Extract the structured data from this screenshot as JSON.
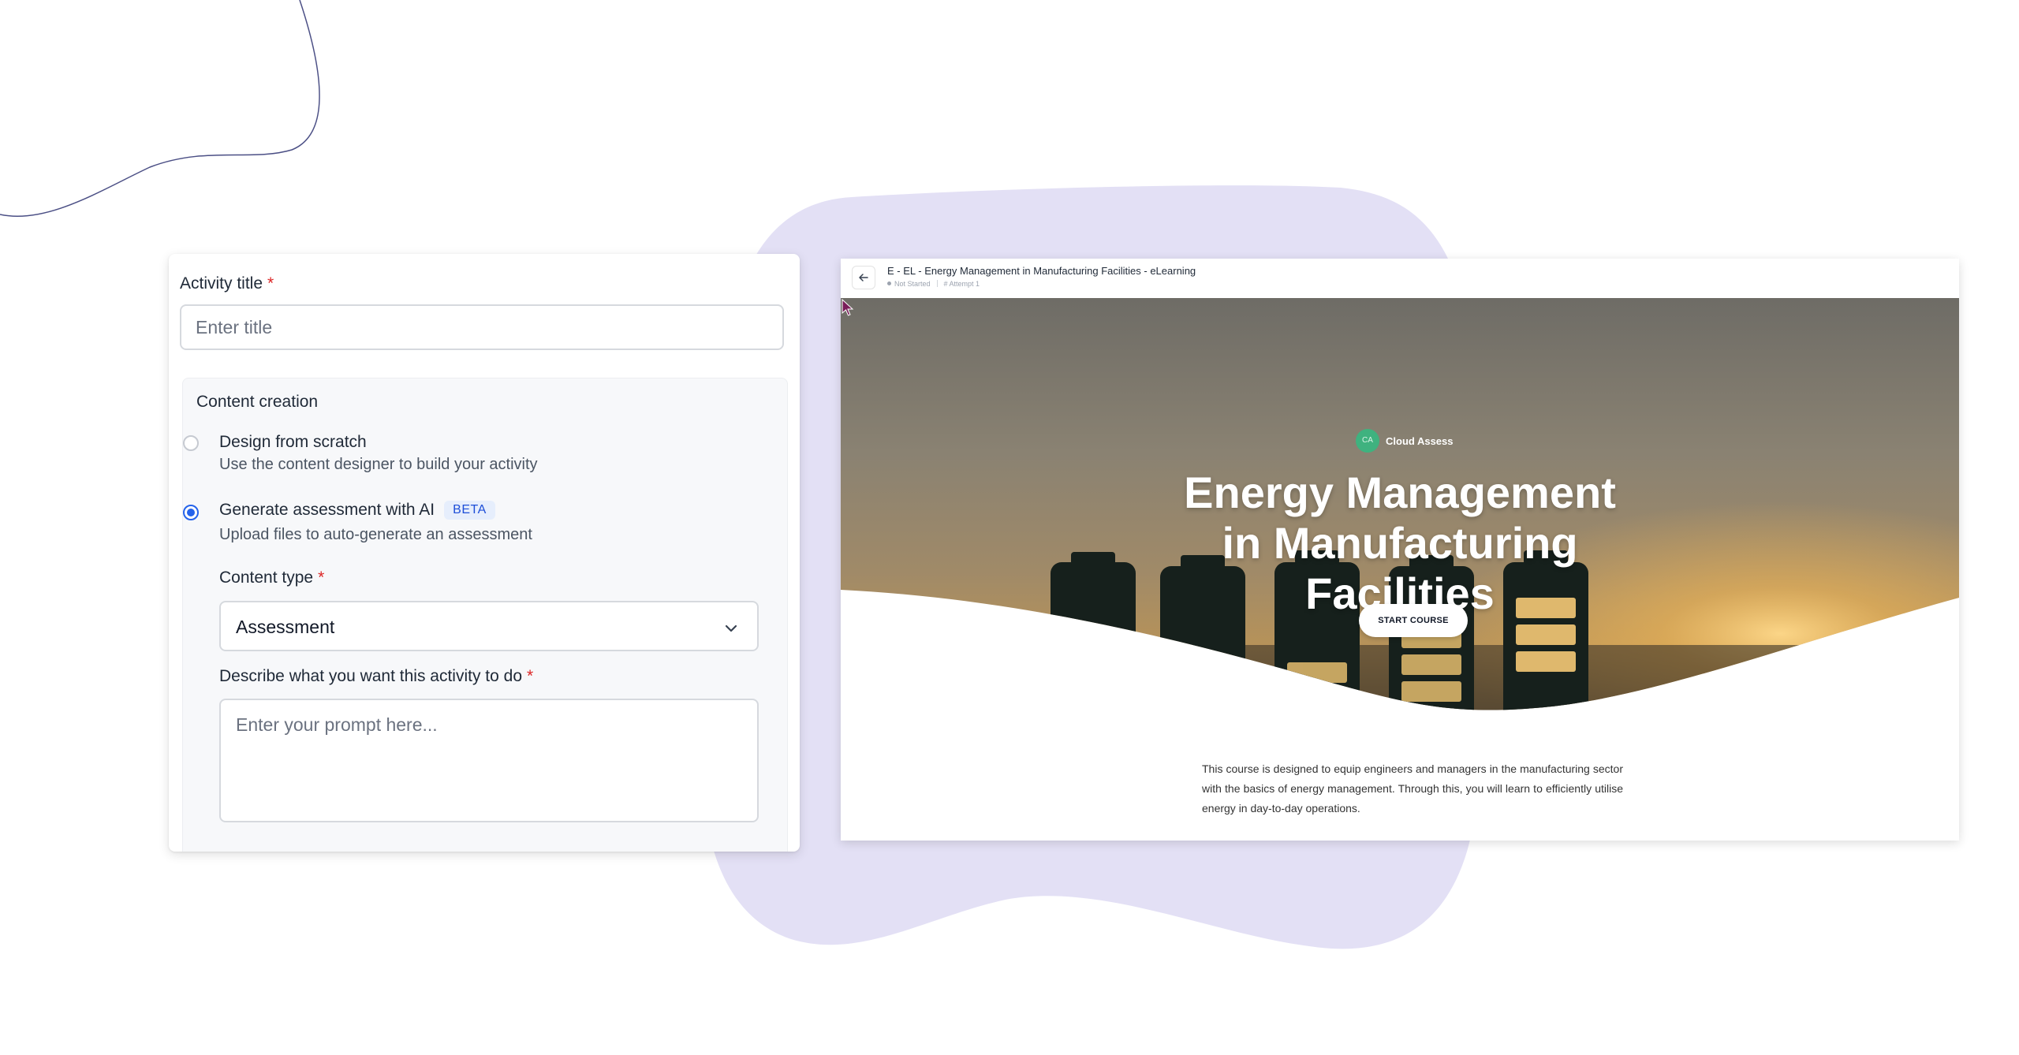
{
  "form": {
    "activity_title_label": "Activity title",
    "required_mark": "*",
    "title_placeholder": "Enter title",
    "content_creation_label": "Content creation",
    "options": [
      {
        "title": "Design from scratch",
        "description": "Use the content designer to build your activity",
        "selected": false
      },
      {
        "title": "Generate assessment with AI",
        "badge": "BETA",
        "description": "Upload files to auto-generate an assessment",
        "selected": true
      }
    ],
    "content_type_label": "Content type",
    "content_type_value": "Assessment",
    "describe_label": "Describe what you want this activity to do",
    "prompt_placeholder": "Enter your prompt here..."
  },
  "preview": {
    "window_title": "E - EL - Energy Management in Manufacturing Facilities - eLearning",
    "status": "Not Started",
    "attempt": "Attempt 1",
    "brand_initials": "CA",
    "brand_name": "Cloud Assess",
    "hero_title": "Energy Management in Manufacturing Facilities",
    "start_button": "START COURSE",
    "description": "This course is designed to equip engineers and managers in the manufacturing sector with the basics of energy management. Through this, you will learn to efficiently utilise energy in day-to-day operations."
  },
  "colors": {
    "accent": "#2563eb",
    "required": "#dc2626",
    "blob": "#e3e0f5",
    "brand_green": "#3fb27f"
  }
}
